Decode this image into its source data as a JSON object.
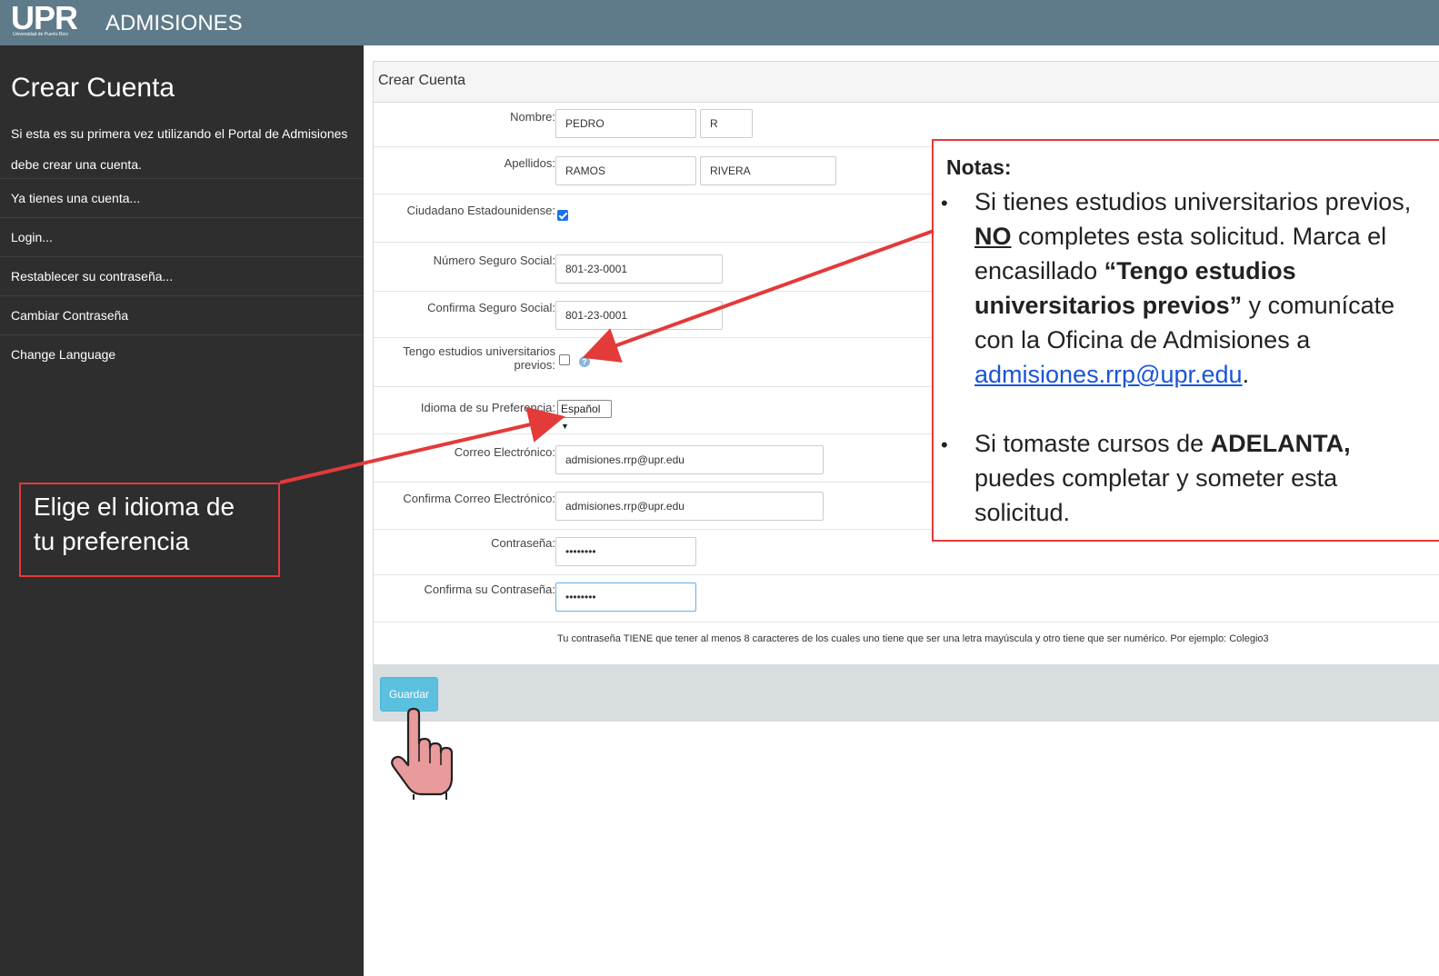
{
  "header": {
    "logo_text": "UPR",
    "logo_sub": "Universidad de Puerto Rico",
    "app_name": "ADMISIONES"
  },
  "sidebar": {
    "title": "Crear Cuenta",
    "description": "Si esta es su primera vez utilizando el Portal de Admisiones debe crear una cuenta.",
    "items": [
      {
        "label": "Ya tienes una cuenta..."
      },
      {
        "label": "Login..."
      },
      {
        "label": " Restablecer su contraseña..."
      },
      {
        "label": "Cambiar Contraseña"
      },
      {
        "label": "Change Language"
      }
    ]
  },
  "form": {
    "title": "Crear Cuenta",
    "nombre": {
      "label": "Nombre:",
      "value": "PEDRO",
      "initial": "R"
    },
    "apellidos": {
      "label": "Apellidos:",
      "paterno": "RAMOS",
      "materno": "RIVERA"
    },
    "ciudadano": {
      "label": "Ciudadano Estadounidense:",
      "checked": true
    },
    "ssn": {
      "label": "Número Seguro Social:",
      "value": "801-23-0001"
    },
    "ssn_confirm": {
      "label": "Confirma Seguro Social:",
      "value": "801-23-0001"
    },
    "estudios": {
      "label_1": "Tengo estudios universitarios",
      "label_2": "previos:",
      "checked": false
    },
    "idioma": {
      "label": "Idioma de su Preferencia:",
      "value": "Español"
    },
    "email": {
      "label": "Correo Electrónico:",
      "value": "admisiones.rrp@upr.edu"
    },
    "email_confirm": {
      "label": "Confirma Correo Electrónico:",
      "value": "admisiones.rrp@upr.edu"
    },
    "password": {
      "label": "Contraseña:",
      "value": "••••••••"
    },
    "password_confirm": {
      "label": "Confirma su Contraseña:",
      "value": "••••••••"
    },
    "password_hint": "Tu contraseña TIENE que tener al menos 8 caracteres de los cuales uno tiene que ser una letra mayúscula y otro tiene que ser numérico. Por ejemplo: Colegio3",
    "save_label": "Guardar"
  },
  "notes": {
    "title": "Notas:",
    "b1_pre": "Si tienes estudios universitarios previos, ",
    "b1_no": "NO",
    "b1_mid": " completes esta solicitud. Marca el encasillado ",
    "b1_bold": "“Tengo estudios universitarios previos”",
    "b1_post": " y comunícate con la Oficina de Admisiones a ",
    "b1_email": "admisiones.rrp@upr.edu",
    "b1_end": ".",
    "b2_pre": "Si tomaste cursos de ",
    "b2_bold": "ADELANTA,",
    "b2_post": " puedes completar y someter esta solicitud."
  },
  "callout": {
    "line1": "Elige el idioma de",
    "line2": " tu preferencia"
  },
  "colors": {
    "header": "#5f7a89",
    "sidebar": "#2e2e2e",
    "accent_red": "#e33a3a",
    "save_button": "#5bc0de",
    "link": "#1a55d4"
  }
}
